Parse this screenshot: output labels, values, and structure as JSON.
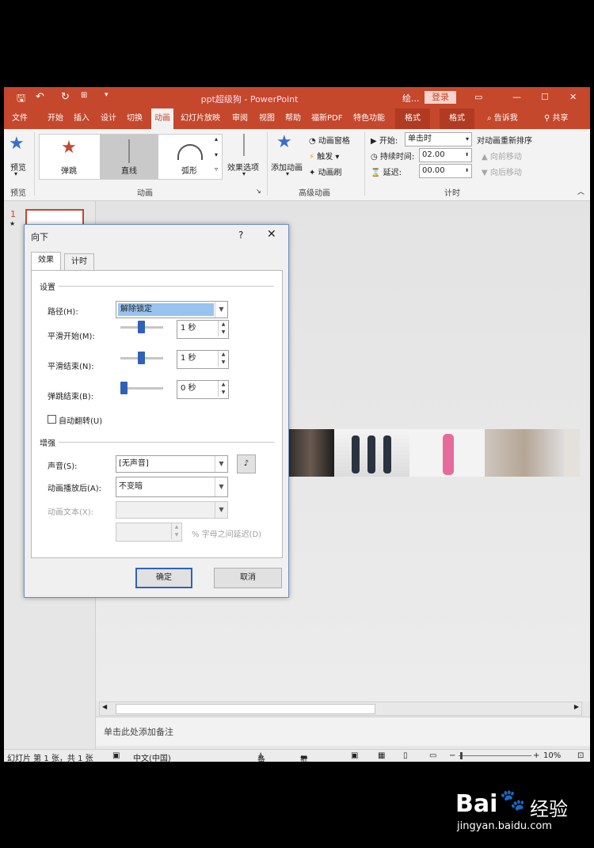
{
  "window": {
    "title": "ppt超级狗 - PowerPoint",
    "search_short": "绘...",
    "login": "登录"
  },
  "tabs": [
    "文件",
    "开始",
    "插入",
    "设计",
    "切换",
    "动画",
    "幻灯片放映",
    "审阅",
    "视图",
    "帮助",
    "福新PDF",
    "特色功能",
    "格式",
    "格式"
  ],
  "tell_me": "告诉我",
  "share": "共享",
  "ribbon": {
    "preview_label": "预览",
    "preview_group": "预览",
    "gallery": [
      "弹跳",
      "直线",
      "弧形"
    ],
    "effect_options": "效果选项",
    "animation_group": "动画",
    "add_animation": "添加动画",
    "anim_pane": "动画窗格",
    "trigger": "触发",
    "anim_painter": "动画刷",
    "advanced_group": "高级动画",
    "start_label": "开始:",
    "start_value": "单击时",
    "duration_label": "持续时间:",
    "duration_value": "02.00",
    "delay_label": "延迟:",
    "delay_value": "00.00",
    "reorder": "对动画重新排序",
    "move_earlier": "向前移动",
    "move_later": "向后移动",
    "timing_group": "计时"
  },
  "slides_pane": {
    "number": "1",
    "star": "★"
  },
  "notes_placeholder": "单击此处添加备注",
  "status": {
    "slide_info": "幻灯片 第 1 张，共 1 张",
    "language": "中文(中国)",
    "notes": "备注",
    "comments": "批注",
    "zoom": "10%"
  },
  "dialog": {
    "title": "向下",
    "help": "?",
    "close": "✕",
    "tab_effect": "效果",
    "tab_timing": "计时",
    "settings_section": "设置",
    "path_label": "路径(H):",
    "path_value": "解除锁定",
    "smooth_start_label": "平滑开始(M):",
    "smooth_start_value": "1 秒",
    "smooth_end_label": "平滑结束(N):",
    "smooth_end_value": "1 秒",
    "bounce_end_label": "弹跳结束(B):",
    "bounce_end_value": "0 秒",
    "auto_reverse_label": "自动翻转(U)",
    "enhance_section": "增强",
    "sound_label": "声音(S):",
    "sound_value": "[无声音]",
    "after_anim_label": "动画播放后(A):",
    "after_anim_value": "不变暗",
    "anim_text_label": "动画文本(X):",
    "delay_between_label": "% 字母之间延迟(D)",
    "ok": "确定",
    "cancel": "取消"
  },
  "watermark": {
    "brand": "Bai",
    "cn": "经验",
    "url": "jingyan.baidu.com"
  },
  "colors": {
    "accent": "#c5472c",
    "slider_thumb": "#2f62b5"
  }
}
